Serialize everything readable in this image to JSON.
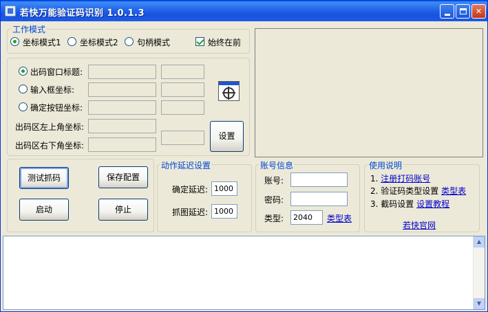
{
  "window": {
    "title": "若快万能验证码识别 1.0.1.3"
  },
  "mode": {
    "legend": "工作模式",
    "options": [
      "坐标模式1",
      "坐标模式2",
      "句柄模式"
    ],
    "selected_index": 0,
    "always_on_top_label": "始终在前",
    "always_on_top": true
  },
  "coords": {
    "rows": [
      {
        "label": "出码窗口标题:"
      },
      {
        "label": "输入框坐标:"
      },
      {
        "label": "确定按钮坐标:"
      },
      {
        "label": "出码区左上角坐标:"
      },
      {
        "label": "出码区右下角坐标:"
      }
    ],
    "settings_button": "设置"
  },
  "actions": {
    "test_button": "测试抓码",
    "save_button": "保存配置",
    "start_button": "启动",
    "stop_button": "停止"
  },
  "delay": {
    "legend": "动作延迟设置",
    "confirm_label": "确定延迟:",
    "confirm_value": "1000",
    "capture_label": "抓图延迟:",
    "capture_value": "1000"
  },
  "account": {
    "legend": "账号信息",
    "username_label": "账号:",
    "username_value": "",
    "password_label": "密码:",
    "password_value": "",
    "type_label": "类型:",
    "type_value": "2040",
    "type_link": "类型表"
  },
  "usage": {
    "legend": "使用说明",
    "items": [
      {
        "text": "1. ",
        "link": "注册打码账号"
      },
      {
        "text": "2. 验证码类型设置 ",
        "link": "类型表"
      },
      {
        "text": "3. 截码设置 ",
        "link": "设置教程"
      }
    ],
    "official_site": "若快官网"
  },
  "colors": {
    "titlebar": "#2769e9",
    "legend_text": "#0046d5",
    "link": "#0000cc",
    "window_bg": "#ece9d8"
  }
}
